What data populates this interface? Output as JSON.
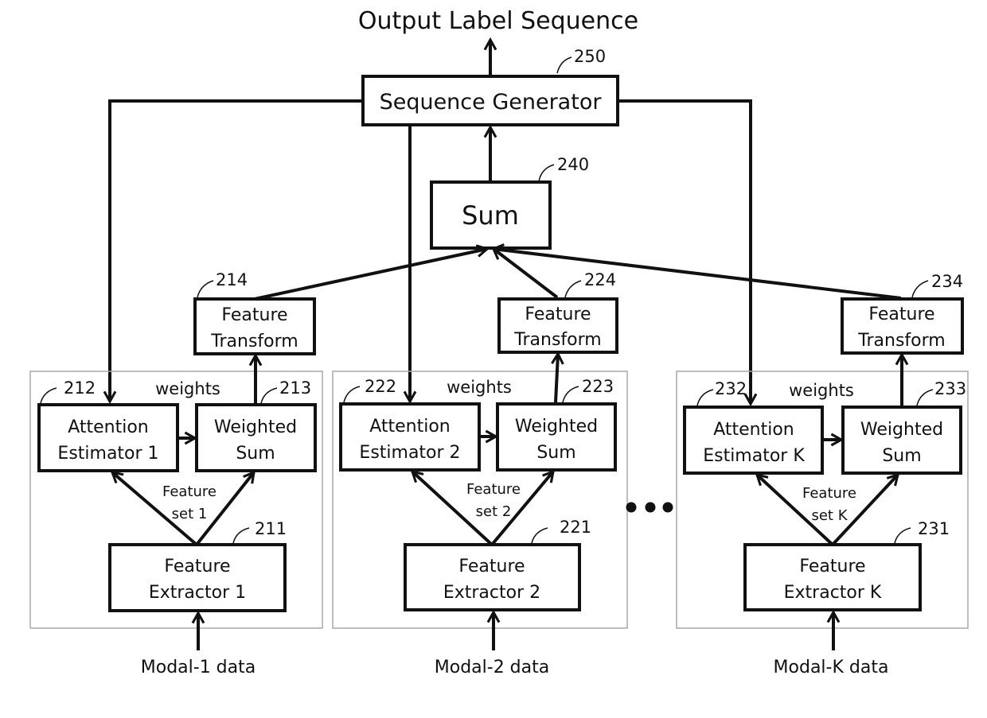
{
  "title": "Output Label Sequence",
  "sequence_generator": {
    "label": "Sequence Generator",
    "ref": "250"
  },
  "sum": {
    "label": "Sum",
    "ref": "240"
  },
  "modalities": [
    {
      "feature_transform": {
        "line1": "Feature",
        "line2": "Transform",
        "ref": "214"
      },
      "attention_estimator": {
        "line1": "Attention",
        "line2": "Estimator 1",
        "ref": "212"
      },
      "weighted_sum": {
        "line1": "Weighted",
        "line2": "Sum",
        "ref": "213"
      },
      "feature_extractor": {
        "line1": "Feature",
        "line2": "Extractor 1",
        "ref": "211"
      },
      "weights_label": "weights",
      "feature_set": {
        "line1": "Feature",
        "line2": "set 1"
      },
      "input_label": "Modal-1 data"
    },
    {
      "feature_transform": {
        "line1": "Feature",
        "line2": "Transform",
        "ref": "224"
      },
      "attention_estimator": {
        "line1": "Attention",
        "line2": "Estimator 2",
        "ref": "222"
      },
      "weighted_sum": {
        "line1": "Weighted",
        "line2": "Sum",
        "ref": "223"
      },
      "feature_extractor": {
        "line1": "Feature",
        "line2": "Extractor 2",
        "ref": "221"
      },
      "weights_label": "weights",
      "feature_set": {
        "line1": "Feature",
        "line2": "set 2"
      },
      "input_label": "Modal-2 data"
    },
    {
      "feature_transform": {
        "line1": "Feature",
        "line2": "Transform",
        "ref": "234"
      },
      "attention_estimator": {
        "line1": "Attention",
        "line2": "Estimator K",
        "ref": "232"
      },
      "weighted_sum": {
        "line1": "Weighted",
        "line2": "Sum",
        "ref": "233"
      },
      "feature_extractor": {
        "line1": "Feature",
        "line2": "Extractor K",
        "ref": "231"
      },
      "weights_label": "weights",
      "feature_set": {
        "line1": "Feature",
        "line2": "set K"
      },
      "input_label": "Modal-K data"
    }
  ],
  "ellipsis_icon": "ellipsis-dots"
}
